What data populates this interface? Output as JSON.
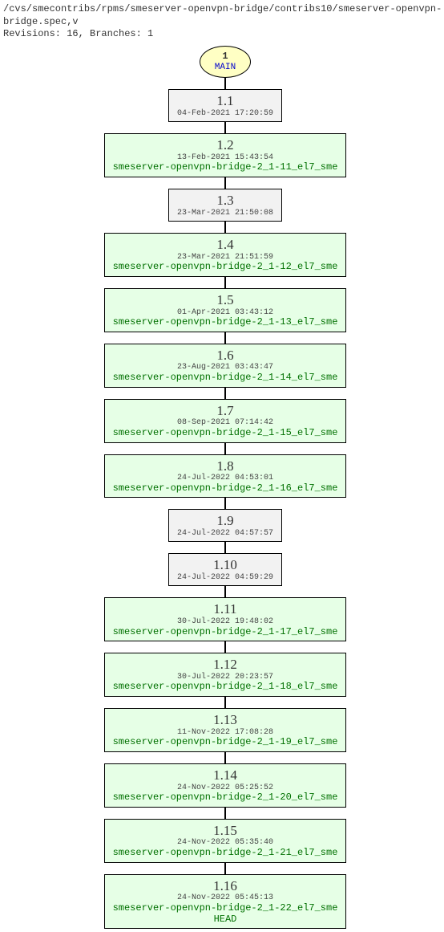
{
  "header": {
    "path": "/cvs/smecontribs/rpms/smeserver-openvpn-bridge/contribs10/smeserver-openvpn-bridge.spec,v",
    "stats": "Revisions: 16, Branches: 1"
  },
  "branch": {
    "number": "1",
    "name": "MAIN"
  },
  "revisions": [
    {
      "rev": "1.1",
      "date": "04-Feb-2021 17:20:59",
      "tag": null,
      "head": false
    },
    {
      "rev": "1.2",
      "date": "13-Feb-2021 15:43:54",
      "tag": "smeserver-openvpn-bridge-2_1-11_el7_sme",
      "head": false
    },
    {
      "rev": "1.3",
      "date": "23-Mar-2021 21:50:08",
      "tag": null,
      "head": false
    },
    {
      "rev": "1.4",
      "date": "23-Mar-2021 21:51:59",
      "tag": "smeserver-openvpn-bridge-2_1-12_el7_sme",
      "head": false
    },
    {
      "rev": "1.5",
      "date": "01-Apr-2021 03:43:12",
      "tag": "smeserver-openvpn-bridge-2_1-13_el7_sme",
      "head": false
    },
    {
      "rev": "1.6",
      "date": "23-Aug-2021 03:43:47",
      "tag": "smeserver-openvpn-bridge-2_1-14_el7_sme",
      "head": false
    },
    {
      "rev": "1.7",
      "date": "08-Sep-2021 07:14:42",
      "tag": "smeserver-openvpn-bridge-2_1-15_el7_sme",
      "head": false
    },
    {
      "rev": "1.8",
      "date": "24-Jul-2022 04:53:01",
      "tag": "smeserver-openvpn-bridge-2_1-16_el7_sme",
      "head": false
    },
    {
      "rev": "1.9",
      "date": "24-Jul-2022 04:57:57",
      "tag": null,
      "head": false
    },
    {
      "rev": "1.10",
      "date": "24-Jul-2022 04:59:29",
      "tag": null,
      "head": false
    },
    {
      "rev": "1.11",
      "date": "30-Jul-2022 19:48:02",
      "tag": "smeserver-openvpn-bridge-2_1-17_el7_sme",
      "head": false
    },
    {
      "rev": "1.12",
      "date": "30-Jul-2022 20:23:57",
      "tag": "smeserver-openvpn-bridge-2_1-18_el7_sme",
      "head": false
    },
    {
      "rev": "1.13",
      "date": "11-Nov-2022 17:08:28",
      "tag": "smeserver-openvpn-bridge-2_1-19_el7_sme",
      "head": false
    },
    {
      "rev": "1.14",
      "date": "24-Nov-2022 05:25:52",
      "tag": "smeserver-openvpn-bridge-2_1-20_el7_sme",
      "head": false
    },
    {
      "rev": "1.15",
      "date": "24-Nov-2022 05:35:40",
      "tag": "smeserver-openvpn-bridge-2_1-21_el7_sme",
      "head": false
    },
    {
      "rev": "1.16",
      "date": "24-Nov-2022 05:45:13",
      "tag": "smeserver-openvpn-bridge-2_1-22_el7_sme",
      "head": true
    }
  ],
  "head_label": "HEAD"
}
